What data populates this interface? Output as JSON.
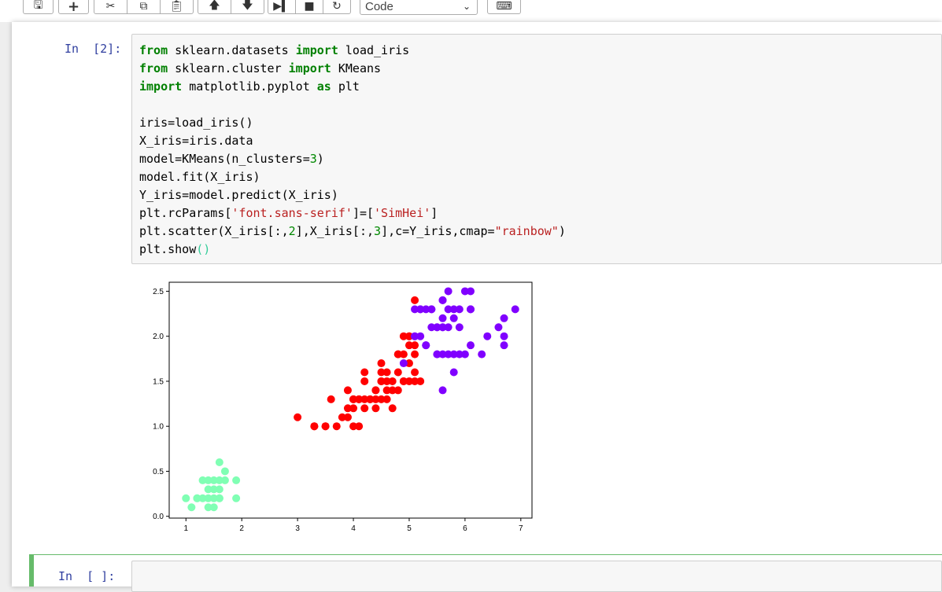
{
  "toolbar": {
    "cell_type": "Code",
    "buttons": [
      "save-icon",
      "insert-cell-icon",
      "cut-icon",
      "copy-icon",
      "paste-icon",
      "move-up-icon",
      "move-down-icon",
      "run-icon",
      "stop-icon",
      "restart-icon",
      "command-palette-icon"
    ]
  },
  "cells": [
    {
      "prompt": "In  [2]:",
      "lines": [
        [
          {
            "t": "from",
            "c": "kw"
          },
          {
            "t": " sklearn.datasets "
          },
          {
            "t": "import",
            "c": "kw"
          },
          {
            "t": " load_iris"
          }
        ],
        [
          {
            "t": "from",
            "c": "kw"
          },
          {
            "t": " sklearn.cluster "
          },
          {
            "t": "import",
            "c": "kw"
          },
          {
            "t": " KMeans"
          }
        ],
        [
          {
            "t": "import",
            "c": "kw"
          },
          {
            "t": " matplotlib.pyplot "
          },
          {
            "t": "as",
            "c": "kw"
          },
          {
            "t": " plt"
          }
        ],
        [
          {
            "t": ""
          }
        ],
        [
          {
            "t": "iris=load_iris()"
          }
        ],
        [
          {
            "t": "X_iris=iris.data"
          }
        ],
        [
          {
            "t": "model=KMeans(n_clusters="
          },
          {
            "t": "3",
            "c": "num"
          },
          {
            "t": ")"
          }
        ],
        [
          {
            "t": "model.fit(X_iris)"
          }
        ],
        [
          {
            "t": "Y_iris=model.predict(X_iris)"
          }
        ],
        [
          {
            "t": "plt.rcParams["
          },
          {
            "t": "'font.sans-serif'",
            "c": "str"
          },
          {
            "t": "]=["
          },
          {
            "t": "'SimHei'",
            "c": "str"
          },
          {
            "t": "]"
          }
        ],
        [
          {
            "t": "plt.scatter(X_iris[:,"
          },
          {
            "t": "2",
            "c": "num"
          },
          {
            "t": "],X_iris[:,"
          },
          {
            "t": "3",
            "c": "num"
          },
          {
            "t": "],c=Y_iris,cmap="
          },
          {
            "t": "\"rainbow\"",
            "c": "str"
          },
          {
            "t": ")"
          }
        ],
        [
          {
            "t": "plt.show"
          },
          {
            "t": "()",
            "c": "paren"
          }
        ]
      ]
    },
    {
      "prompt": "In  [ ]:",
      "lines": []
    }
  ],
  "chart_data": {
    "type": "scatter",
    "title": "",
    "xlabel": "",
    "ylabel": "",
    "xlim": [
      0.7,
      7.2
    ],
    "ylim": [
      -0.02,
      2.6
    ],
    "xticks": [
      1,
      2,
      3,
      4,
      5,
      6,
      7
    ],
    "yticks": [
      0.0,
      0.5,
      1.0,
      1.5,
      2.0,
      2.5
    ],
    "ytick_labels": [
      "0.0",
      "0.5",
      "1.0",
      "1.5",
      "2.0",
      "2.5"
    ],
    "grid": false,
    "series": [
      {
        "color": "#80ffb4",
        "points": [
          [
            1.4,
            0.2
          ],
          [
            1.3,
            0.2
          ],
          [
            1.5,
            0.2
          ],
          [
            1.7,
            0.4
          ],
          [
            1.4,
            0.3
          ],
          [
            1.5,
            0.1
          ],
          [
            1.6,
            0.2
          ],
          [
            1.1,
            0.1
          ],
          [
            1.2,
            0.2
          ],
          [
            1.3,
            0.4
          ],
          [
            1.0,
            0.2
          ],
          [
            1.7,
            0.5
          ],
          [
            1.9,
            0.2
          ],
          [
            1.6,
            0.4
          ],
          [
            1.4,
            0.1
          ],
          [
            1.5,
            0.4
          ],
          [
            1.5,
            0.3
          ],
          [
            1.6,
            0.6
          ],
          [
            1.9,
            0.4
          ],
          [
            1.6,
            0.3
          ],
          [
            1.2,
            0.2
          ],
          [
            1.4,
            0.4
          ],
          [
            1.6,
            0.2
          ]
        ]
      },
      {
        "color": "#ff0000",
        "points": [
          [
            4.7,
            1.4
          ],
          [
            4.5,
            1.5
          ],
          [
            4.0,
            1.3
          ],
          [
            4.6,
            1.5
          ],
          [
            4.5,
            1.3
          ],
          [
            3.3,
            1.0
          ],
          [
            4.6,
            1.3
          ],
          [
            3.9,
            1.4
          ],
          [
            3.5,
            1.0
          ],
          [
            4.2,
            1.5
          ],
          [
            4.0,
            1.0
          ],
          [
            3.6,
            1.3
          ],
          [
            4.4,
            1.4
          ],
          [
            4.1,
            1.0
          ],
          [
            4.5,
            1.5
          ],
          [
            3.9,
            1.1
          ],
          [
            4.8,
            1.8
          ],
          [
            4.0,
            1.3
          ],
          [
            4.9,
            1.5
          ],
          [
            4.7,
            1.2
          ],
          [
            4.3,
            1.3
          ],
          [
            4.4,
            1.4
          ],
          [
            4.8,
            1.4
          ],
          [
            5.0,
            1.7
          ],
          [
            3.5,
            1.0
          ],
          [
            3.8,
            1.1
          ],
          [
            3.7,
            1.0
          ],
          [
            3.9,
            1.2
          ],
          [
            5.1,
            1.6
          ],
          [
            4.5,
            1.6
          ],
          [
            4.7,
            1.5
          ],
          [
            4.4,
            1.3
          ],
          [
            4.1,
            1.3
          ],
          [
            4.0,
            1.3
          ],
          [
            4.4,
            1.2
          ],
          [
            4.6,
            1.4
          ],
          [
            4.0,
            1.2
          ],
          [
            3.3,
            1.0
          ],
          [
            4.2,
            1.3
          ],
          [
            4.2,
            1.2
          ],
          [
            4.3,
            1.3
          ],
          [
            3.0,
            1.1
          ],
          [
            4.1,
            1.3
          ],
          [
            5.1,
            2.4
          ],
          [
            5.0,
            2.0
          ],
          [
            4.9,
            1.8
          ],
          [
            4.8,
            1.8
          ],
          [
            5.0,
            1.5
          ],
          [
            5.1,
            1.5
          ],
          [
            4.9,
            2.0
          ],
          [
            5.1,
            1.9
          ],
          [
            4.8,
            1.6
          ],
          [
            5.0,
            1.9
          ],
          [
            5.1,
            1.8
          ],
          [
            4.5,
            1.7
          ],
          [
            4.9,
            1.5
          ],
          [
            5.0,
            2.0
          ],
          [
            4.2,
            1.6
          ],
          [
            4.6,
            1.6
          ],
          [
            5.2,
            1.5
          ]
        ]
      },
      {
        "color": "#8000ff",
        "points": [
          [
            4.9,
            1.7
          ],
          [
            6.0,
            2.5
          ],
          [
            5.9,
            2.1
          ],
          [
            5.6,
            1.8
          ],
          [
            5.8,
            2.2
          ],
          [
            6.6,
            2.1
          ],
          [
            6.3,
            1.8
          ],
          [
            6.1,
            2.5
          ],
          [
            5.1,
            2.0
          ],
          [
            5.3,
            1.9
          ],
          [
            5.5,
            2.1
          ],
          [
            5.3,
            2.3
          ],
          [
            5.5,
            1.8
          ],
          [
            6.7,
            2.2
          ],
          [
            6.9,
            2.3
          ],
          [
            5.7,
            2.3
          ],
          [
            6.7,
            2.0
          ],
          [
            5.7,
            2.1
          ],
          [
            6.0,
            1.8
          ],
          [
            5.8,
            1.6
          ],
          [
            6.1,
            1.9
          ],
          [
            6.4,
            2.0
          ],
          [
            5.6,
            2.2
          ],
          [
            5.6,
            1.4
          ],
          [
            6.1,
            2.3
          ],
          [
            5.6,
            2.4
          ],
          [
            5.5,
            1.8
          ],
          [
            5.4,
            2.1
          ],
          [
            5.6,
            2.4
          ],
          [
            5.1,
            2.3
          ],
          [
            5.9,
            2.3
          ],
          [
            5.7,
            2.5
          ],
          [
            5.2,
            2.3
          ],
          [
            5.4,
            2.3
          ],
          [
            5.2,
            2.0
          ],
          [
            5.7,
            1.8
          ],
          [
            5.9,
            1.8
          ],
          [
            6.7,
            1.9
          ],
          [
            5.8,
            1.8
          ],
          [
            5.6,
            2.1
          ],
          [
            6.1,
            2.3
          ],
          [
            5.2,
            2.3
          ],
          [
            5.3,
            1.9
          ],
          [
            5.6,
            2.1
          ],
          [
            5.4,
            2.3
          ],
          [
            5.5,
            2.1
          ],
          [
            5.8,
            2.3
          ],
          [
            5.1,
            2.0
          ]
        ]
      }
    ]
  }
}
